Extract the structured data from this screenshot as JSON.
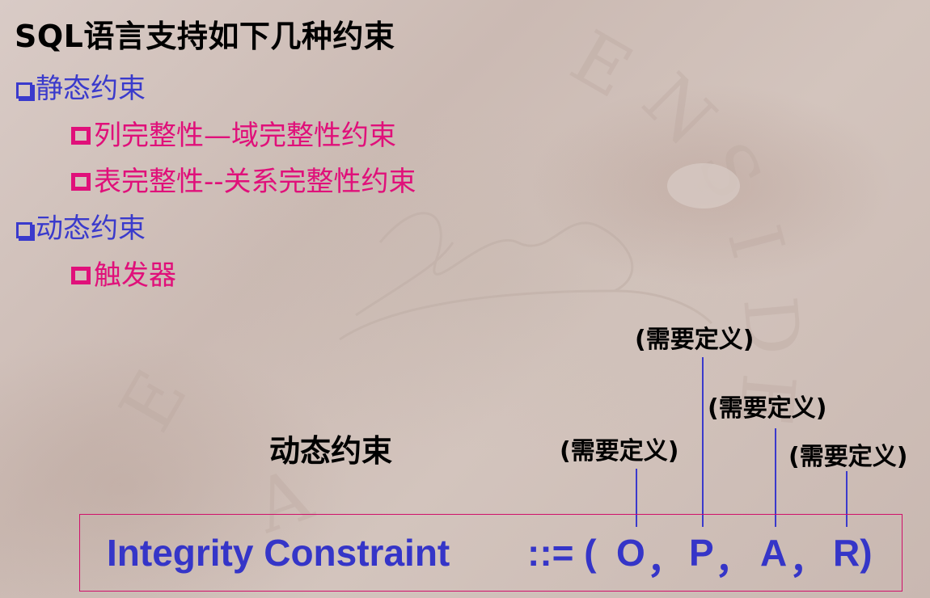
{
  "title": "SQL语言支持如下几种约束",
  "items": [
    {
      "label": "静态约束",
      "children": [
        "列完整性—域完整性约束",
        "表完整性--关系完整性约束"
      ]
    },
    {
      "label": "动态约束",
      "children": [
        "触发器"
      ]
    }
  ],
  "diagram": {
    "heading": "动态约束",
    "notes": [
      "(需要定义)",
      "(需要定义)",
      "(需要定义)",
      "(需要定义)"
    ],
    "formula": {
      "lhs": "Integrity Constraint",
      "op": "::= (",
      "o": "O",
      "sep": "，",
      "p": "P",
      "a": "A",
      "r": "R)"
    }
  },
  "colors": {
    "level1": "#3a3acc",
    "level2": "#e0107a",
    "formula": "#3535c8",
    "box_border": "#d0106a"
  }
}
